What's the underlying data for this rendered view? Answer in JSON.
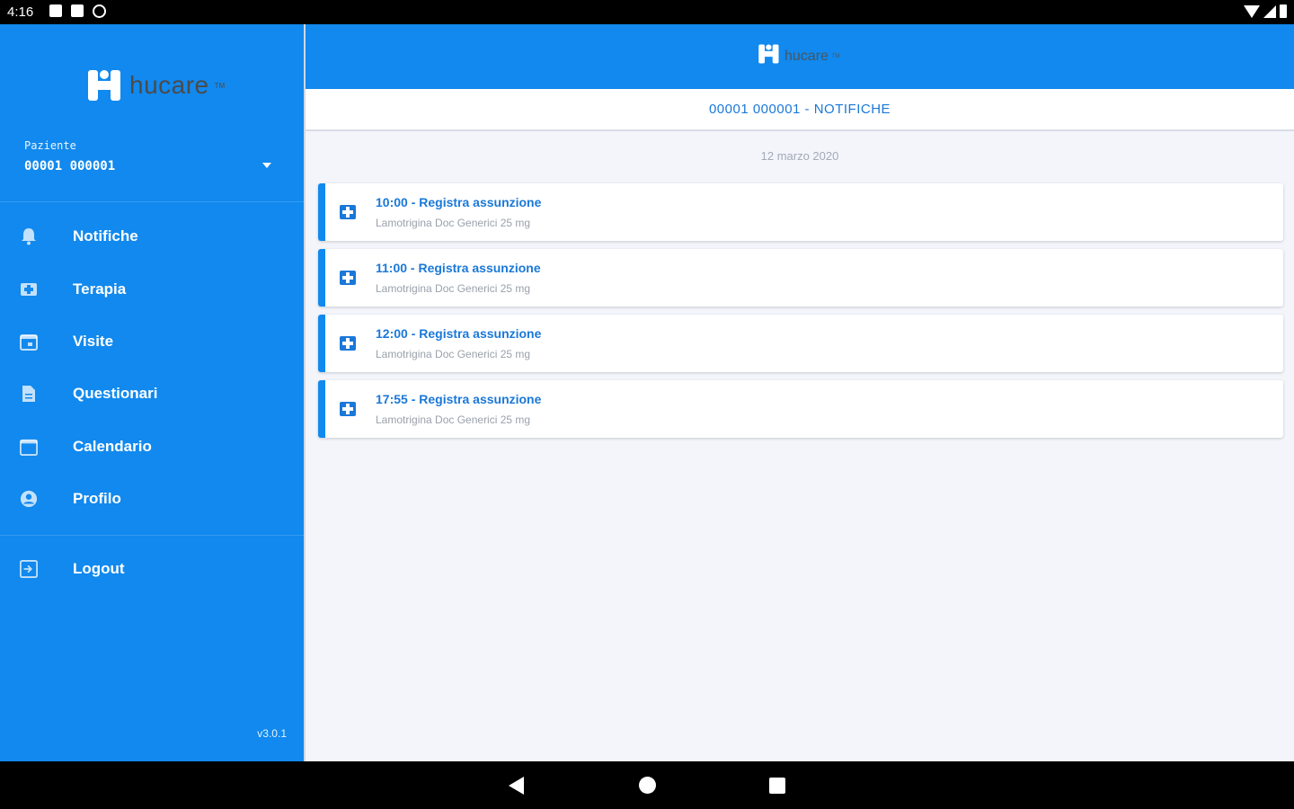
{
  "status_bar": {
    "time": "4:16"
  },
  "drawer": {
    "logo_text": "hucare",
    "logo_tm": "TM",
    "patient_label": "Paziente",
    "patient_value": "00001 000001",
    "menu": [
      {
        "label": "Notifiche",
        "icon": "bell-icon"
      },
      {
        "label": "Terapia",
        "icon": "pill-icon"
      },
      {
        "label": "Visite",
        "icon": "calendar-visit-icon"
      },
      {
        "label": "Questionari",
        "icon": "document-icon"
      },
      {
        "label": "Calendario",
        "icon": "calendar-icon"
      },
      {
        "label": "Profilo",
        "icon": "account-icon"
      }
    ],
    "logout_label": "Logout",
    "version": "v3.0.1"
  },
  "appbar": {
    "logo_text": "hucare",
    "logo_tm": "TM"
  },
  "page": {
    "title": "00001 000001 - NOTIFICHE",
    "date": "12 marzo 2020"
  },
  "notifications": [
    {
      "title": "10:00 - Registra assunzione",
      "subtitle": "Lamotrigina Doc Generici 25 mg"
    },
    {
      "title": "11:00 - Registra assunzione",
      "subtitle": "Lamotrigina Doc Generici 25 mg"
    },
    {
      "title": "12:00 - Registra assunzione",
      "subtitle": "Lamotrigina Doc Generici 25 mg"
    },
    {
      "title": "17:55 - Registra assunzione",
      "subtitle": "Lamotrigina Doc Generici 25 mg"
    }
  ],
  "colors": {
    "primary": "#1189ee",
    "accent_text": "#1a78d8",
    "background": "#f3f5fb"
  }
}
